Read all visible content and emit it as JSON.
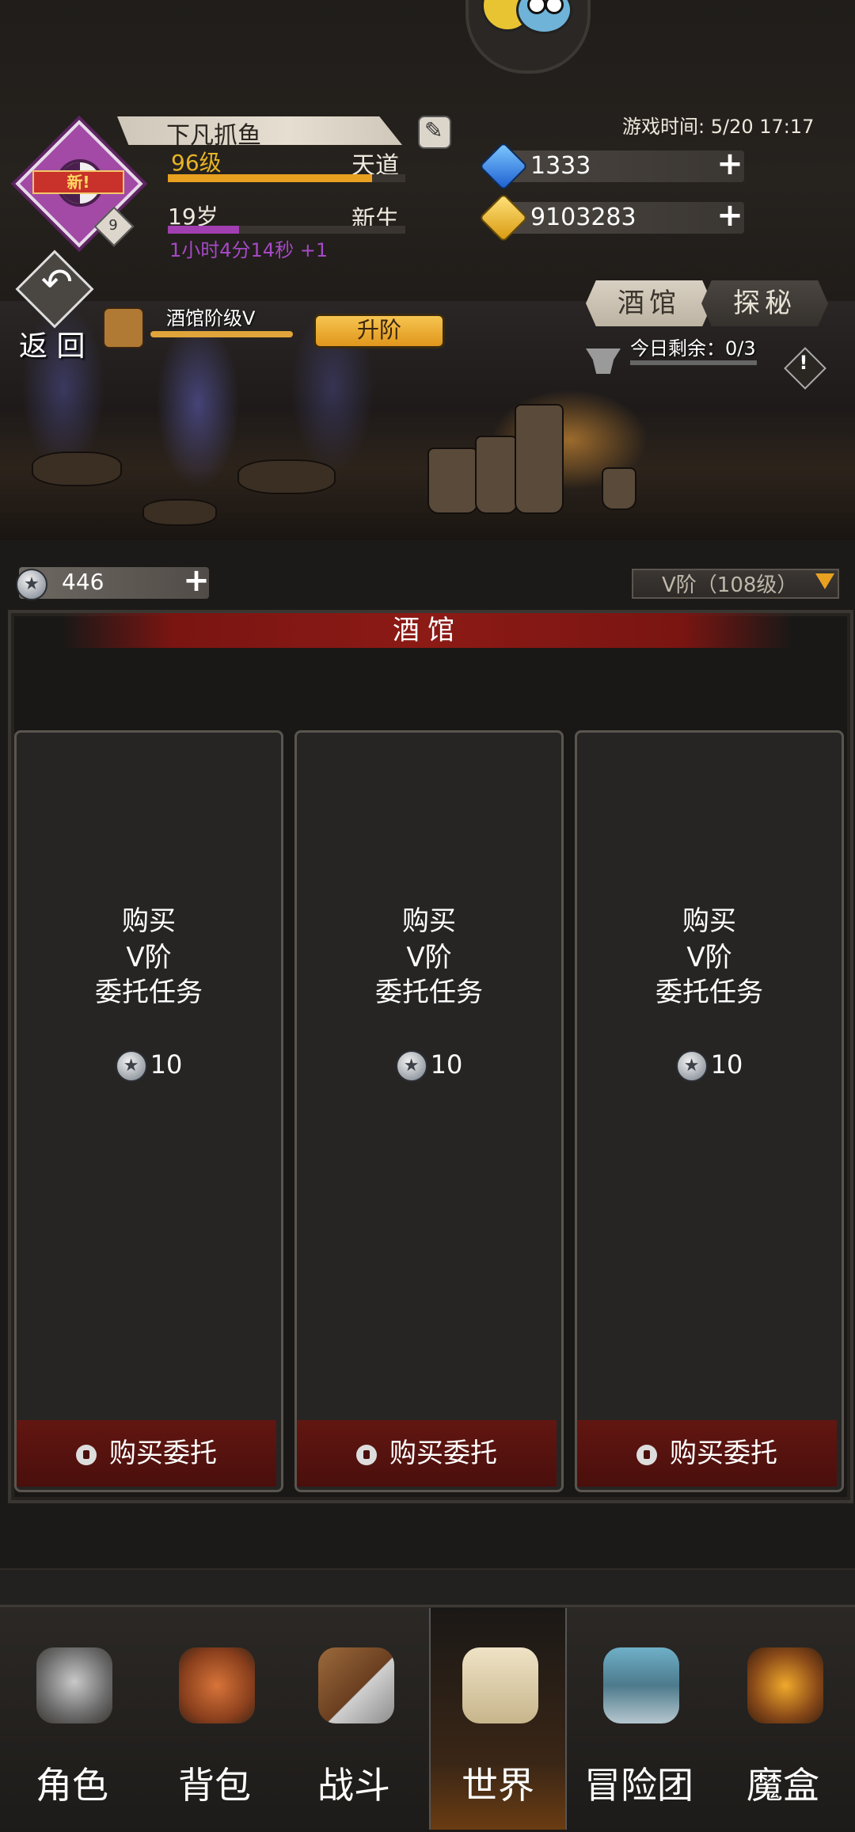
{
  "header": {
    "player_name": "下凡抓鱼",
    "level_text": "96级",
    "level_progress": 0.86,
    "realm": "天道",
    "age_text": "19岁",
    "age_progress": 0.3,
    "state": "新生",
    "timer": "1小时4分14秒 +1",
    "game_time": "游戏时间: 5/20 17:17",
    "avatar_badge": "新!",
    "avatar_level": "9"
  },
  "resources": {
    "gems": "1333",
    "gold": "9103283"
  },
  "scene": {
    "back_label": "返 回",
    "tavern_level_label": "酒馆阶级V",
    "upgrade_label": "升阶",
    "tabs": [
      "酒馆",
      "探秘"
    ],
    "remaining": "今日剩余：0/3"
  },
  "currency": {
    "silver": "446",
    "tier_select": "V阶（108级）"
  },
  "panel": {
    "title": "酒馆",
    "cards": [
      {
        "line1": "购买",
        "line2": "V阶",
        "line3": "委托任务",
        "price": "10",
        "button": "购买委托"
      },
      {
        "line1": "购买",
        "line2": "V阶",
        "line3": "委托任务",
        "price": "10",
        "button": "购买委托"
      },
      {
        "line1": "购买",
        "line2": "V阶",
        "line3": "委托任务",
        "price": "10",
        "button": "购买委托"
      }
    ]
  },
  "nav": {
    "items": [
      {
        "label": "角色",
        "icon": "helmet-icon"
      },
      {
        "label": "背包",
        "icon": "backpack-icon"
      },
      {
        "label": "战斗",
        "icon": "sword-shield-icon"
      },
      {
        "label": "世界",
        "icon": "scroll-icon"
      },
      {
        "label": "冒险团",
        "icon": "castle-icon"
      },
      {
        "label": "魔盒",
        "icon": "magic-box-icon"
      }
    ],
    "active": "世界"
  },
  "colors": {
    "accent_gold": "#e8a020",
    "age_purple": "#a13fb1",
    "panel_red": "#8c1a15"
  }
}
